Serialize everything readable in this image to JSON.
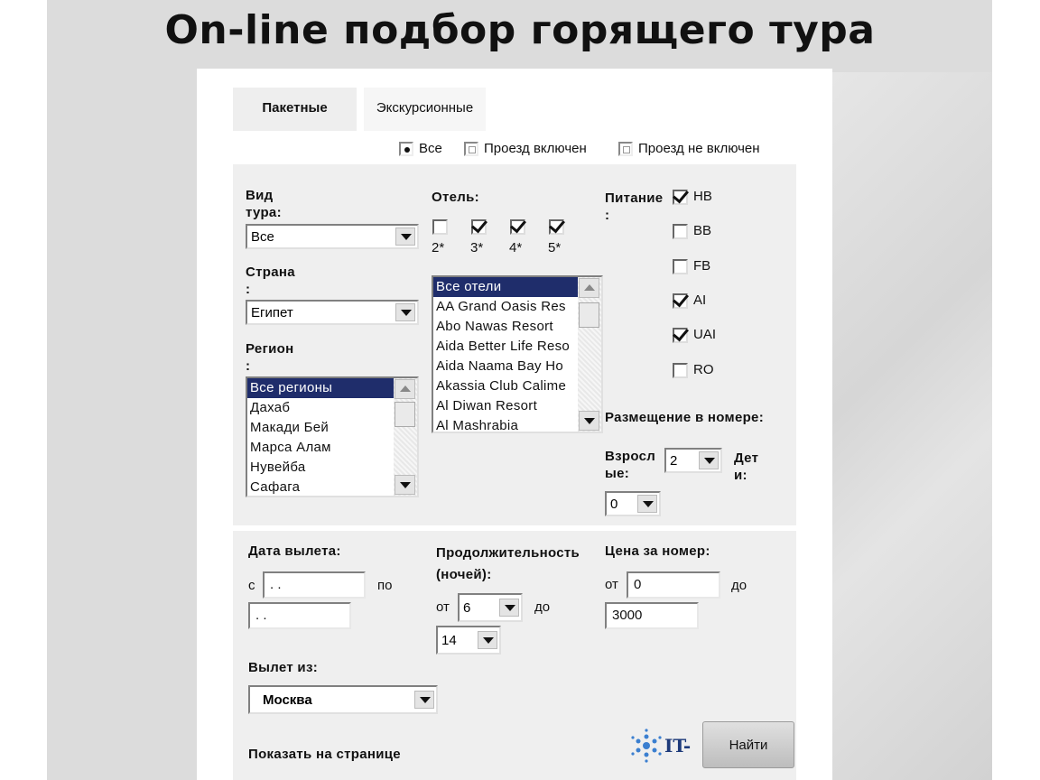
{
  "title": "On-line подбор горящего тура",
  "tabs": [
    {
      "label": "Пакетные",
      "active": true
    },
    {
      "label": "Экскурсионные",
      "active": false
    }
  ],
  "travel_options": [
    {
      "label": "Все",
      "selected": true
    },
    {
      "label": "Проезд включен",
      "selected": false
    },
    {
      "label": "Проезд не включен",
      "selected": false
    }
  ],
  "tour_type": {
    "label_line1": "Вид",
    "label_line2": "тура:",
    "value": "Все"
  },
  "country": {
    "label_line1": "Страна",
    "label_line2": ":",
    "value": "Египет"
  },
  "region": {
    "label_line1": "Регион",
    "label_line2": ":",
    "items": [
      "Все регионы",
      "Дахаб",
      "Макади Бей",
      "Марса Алам",
      "Нувейба",
      "Сафага"
    ]
  },
  "hotel": {
    "label": "Отель:",
    "stars": [
      {
        "label": "2*",
        "checked": false
      },
      {
        "label": "3*",
        "checked": true
      },
      {
        "label": "4*",
        "checked": true
      },
      {
        "label": "5*",
        "checked": true
      }
    ],
    "items": [
      "Все отели",
      "AA Grand Oasis Res",
      "Abo Nawas Resort",
      "Aida Better Life Reso",
      "Aida Naama Bay Ho",
      "Akassia Club Calime",
      "Al Diwan Resort",
      "Al Mashrabia"
    ]
  },
  "meal": {
    "label_line1": "Питание",
    "label_line2": ":",
    "options": [
      {
        "label": "HB",
        "checked": true
      },
      {
        "label": "BB",
        "checked": false
      },
      {
        "label": "FB",
        "checked": false
      },
      {
        "label": "AI",
        "checked": true
      },
      {
        "label": "UAI",
        "checked": true
      },
      {
        "label": "RO",
        "checked": false
      }
    ]
  },
  "room": {
    "label": "Размещение в номере:",
    "adults_label_line1": "Взросл",
    "adults_label_line2": "ые:",
    "adults_value": "2",
    "children_label_line1": "Дет",
    "children_label_line2": "и:",
    "children_value": "0"
  },
  "departure_date": {
    "label": "Дата вылета:",
    "from_label": "с",
    "from_value": " .  .",
    "to_label": "по",
    "to_value": " .  ."
  },
  "duration": {
    "label_line1": "Продолжительность",
    "label_line2": "(ночей):",
    "from_label": "от",
    "from_value": "6",
    "to_label": "до",
    "to_value": "14"
  },
  "price": {
    "label": "Цена за номер:",
    "from_label": "от",
    "from_value": "0",
    "to_label": "до",
    "to_value": "3000"
  },
  "departure_city": {
    "label": "Вылет из:",
    "value": "Москва"
  },
  "show_per_page_label": "Показать на странице",
  "logo_text": "IT-",
  "search_button": "Найти"
}
